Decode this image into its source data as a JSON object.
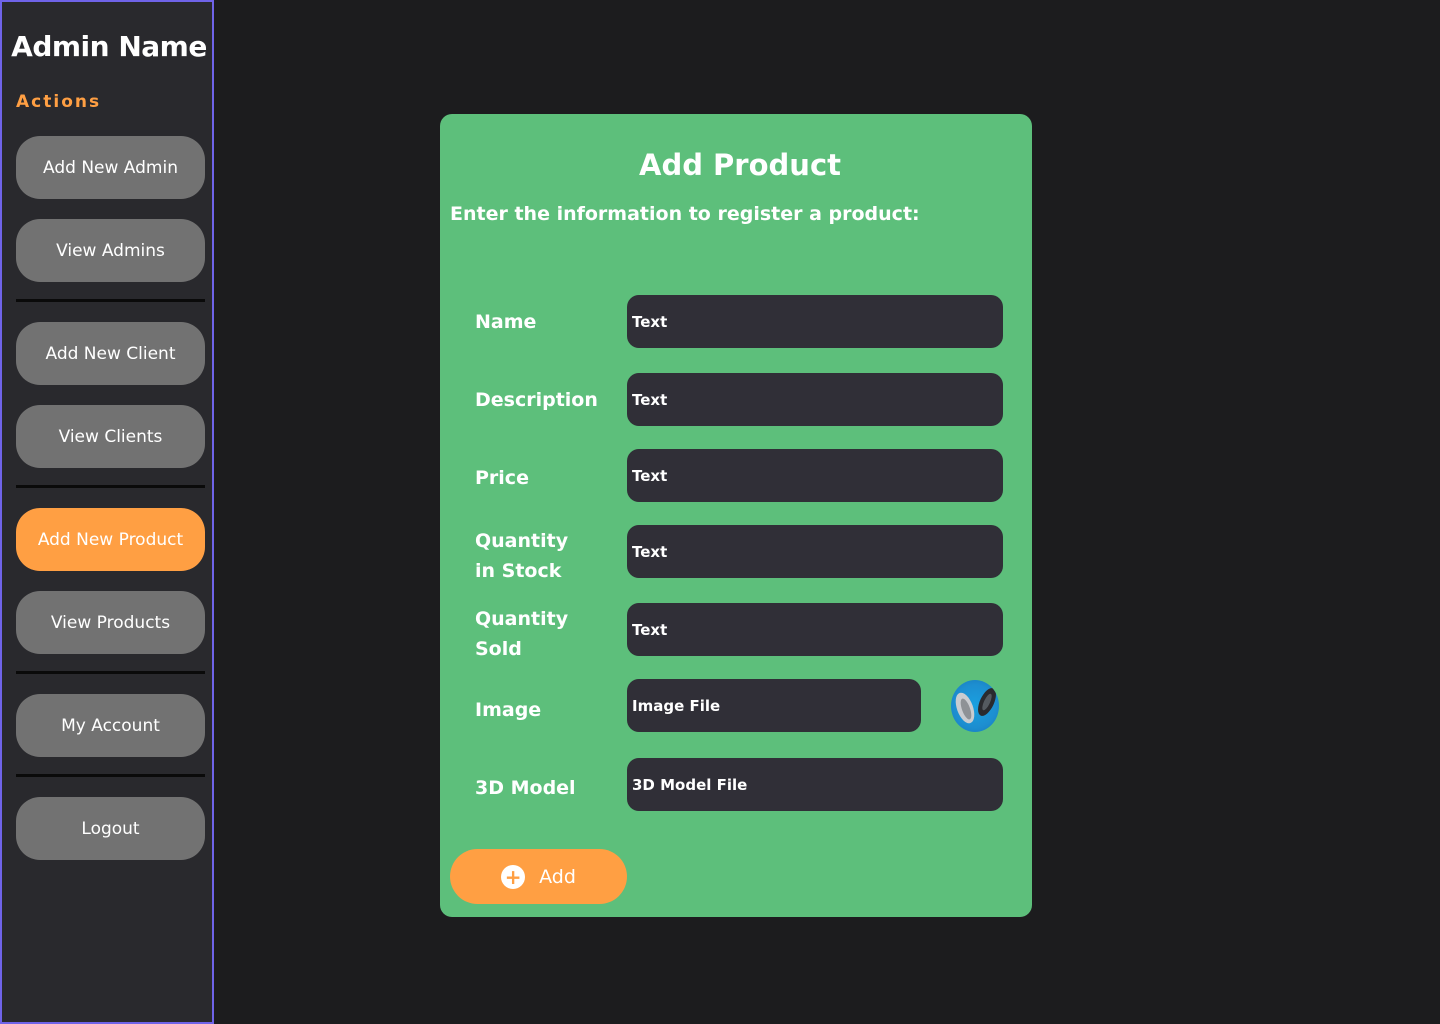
{
  "sidebar": {
    "admin_name": "Admin Name",
    "actions_label": "Actions",
    "buttons": {
      "add_new_admin": "Add New Admin",
      "view_admins": "View Admins",
      "add_new_client": "Add New Client",
      "view_clients": "View Clients",
      "add_new_product": "Add New Product",
      "view_products": "View Products",
      "my_account": "My Account",
      "logout": "Logout"
    },
    "active_item": "add_new_product"
  },
  "form": {
    "title": "Add Product",
    "subtitle": "Enter the information to register a product:",
    "fields": {
      "name": {
        "label": "Name",
        "value": "Text"
      },
      "description": {
        "label": "Description",
        "value": "Text"
      },
      "price": {
        "label": "Price",
        "value": "Text"
      },
      "quantity_in_stock": {
        "label_line1": "Quantity",
        "label_line2": "in Stock",
        "value": "Text"
      },
      "quantity_sold": {
        "label_line1": "Quantity",
        "label_line2": "Sold",
        "value": "Text"
      },
      "image": {
        "label": "Image",
        "value": "Image File"
      },
      "model_3d": {
        "label": "3D Model",
        "value": "3D Model File"
      }
    },
    "submit_label": "Add"
  },
  "colors": {
    "background": "#1c1c1e",
    "sidebar": "#29292d",
    "sidebar_border": "#6f63e8",
    "accent": "#ff9f43",
    "card": "#5dbf7b",
    "input": "#302f37",
    "button_gray": "#727272"
  },
  "icons": {
    "add_button": "plus-circle-icon",
    "image_preview": "image-thumbnail"
  }
}
